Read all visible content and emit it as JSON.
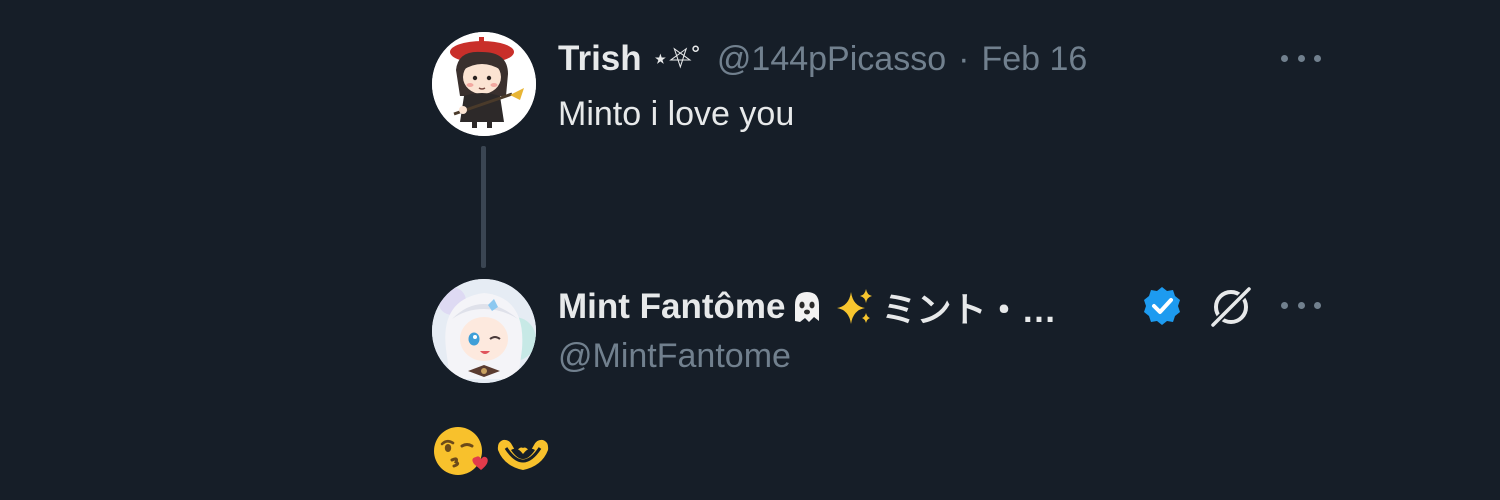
{
  "tweet": {
    "author": {
      "name": "Trish",
      "name_decoration": "⋆⛧˚",
      "handle": "@144pPicasso",
      "separator": "·",
      "date": "Feb 16"
    },
    "text": "Minto i love you",
    "more_icon": "more-horizontal-icon"
  },
  "reply": {
    "author": {
      "name": "Mint Fantôme",
      "name_suffix": "ミント・…",
      "name_emojis": [
        "ghost-emoji",
        "sparkles-emoji"
      ],
      "handle": "@MintFantome",
      "verified": true,
      "verified_color": "#1d9bf0",
      "affiliate_icon": "x-grok-icon"
    },
    "emojis": [
      "kissing-face-with-heart-emoji",
      "heart-hands-emoji"
    ],
    "more_icon": "more-horizontal-icon"
  },
  "colors": {
    "background": "#161e28",
    "primary_text": "#e7e9ea",
    "secondary_text": "#71808e",
    "thread_line": "#3a4552"
  }
}
